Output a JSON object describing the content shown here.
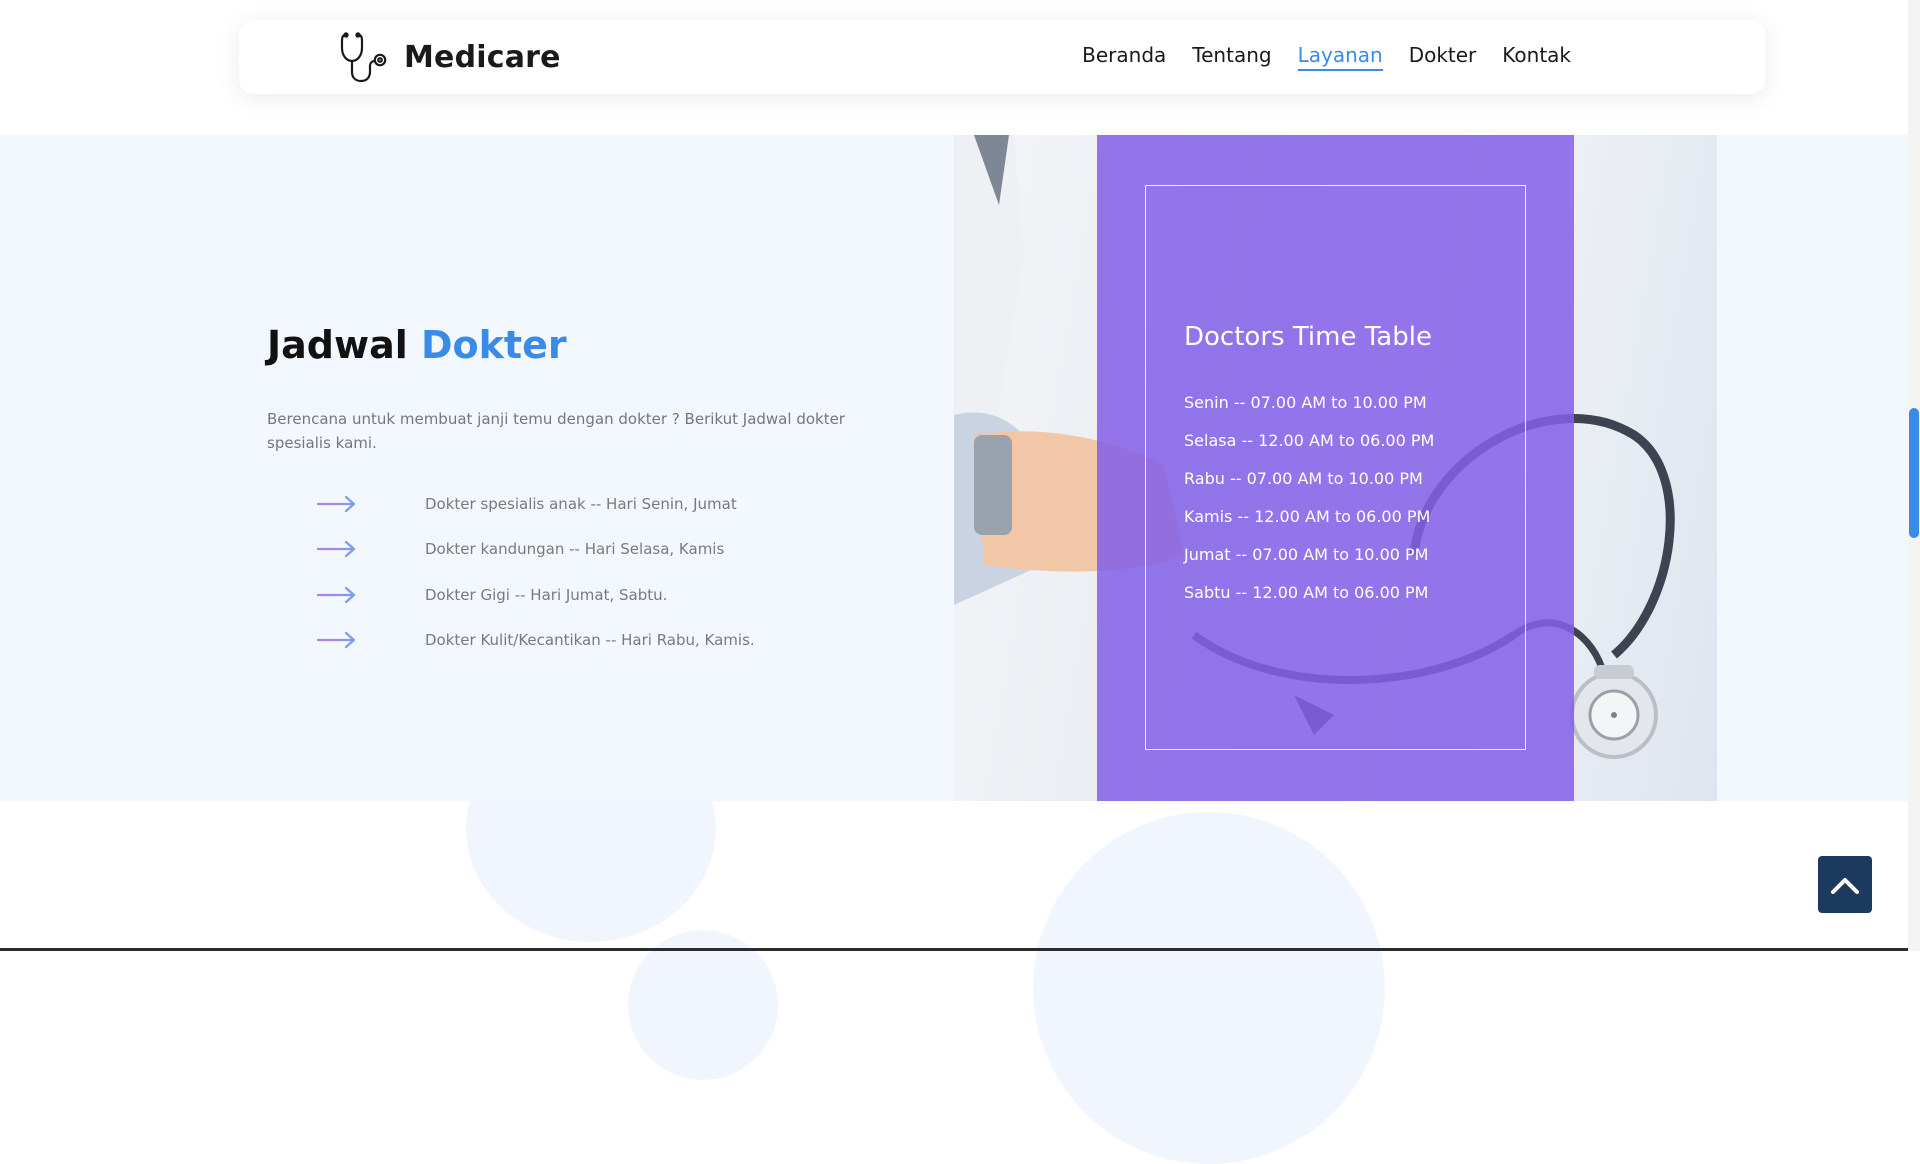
{
  "brand": {
    "name": "Medicare",
    "icon": "stethoscope-icon"
  },
  "nav": {
    "items": [
      {
        "label": "Beranda",
        "active": false
      },
      {
        "label": "Tentang",
        "active": false
      },
      {
        "label": "Layanan",
        "active": true
      },
      {
        "label": "Dokter",
        "active": false
      },
      {
        "label": "Kontak",
        "active": false
      }
    ]
  },
  "schedule": {
    "title_plain": "Jadwal",
    "title_accent": "Dokter",
    "description": "Berencana untuk membuat janji temu dengan dokter ? Berikut Jadwal dokter spesialis kami.",
    "doctors": [
      "Dokter spesialis anak -- Hari Senin, Jumat",
      "Dokter kandungan -- Hari Selasa, Kamis",
      "Dokter Gigi -- Hari Jumat, Sabtu.",
      "Dokter Kulit/Kecantikan -- Hari Rabu, Kamis."
    ]
  },
  "timetable": {
    "title": "Doctors Time Table",
    "rows": [
      "Senin -- 07.00 AM to 10.00 PM",
      "Selasa -- 12.00 AM to 06.00 PM",
      "Rabu -- 07.00 AM to 10.00 PM",
      "Kamis -- 12.00 AM to 06.00 PM",
      "Jumat -- 07.00 AM to 10.00 PM",
      "Sabtu -- 12.00 AM to 06.00 PM"
    ]
  },
  "back_to_top": {
    "icon": "chevron-up-icon"
  },
  "colors": {
    "accent": "#3a8be8",
    "timetable_bg": "#8460e8",
    "section_bg": "#f3f7fe",
    "back_to_top_bg": "#1c3a5e",
    "arrow_gradient": [
      "#b77ee8",
      "#7a9ef0"
    ]
  }
}
